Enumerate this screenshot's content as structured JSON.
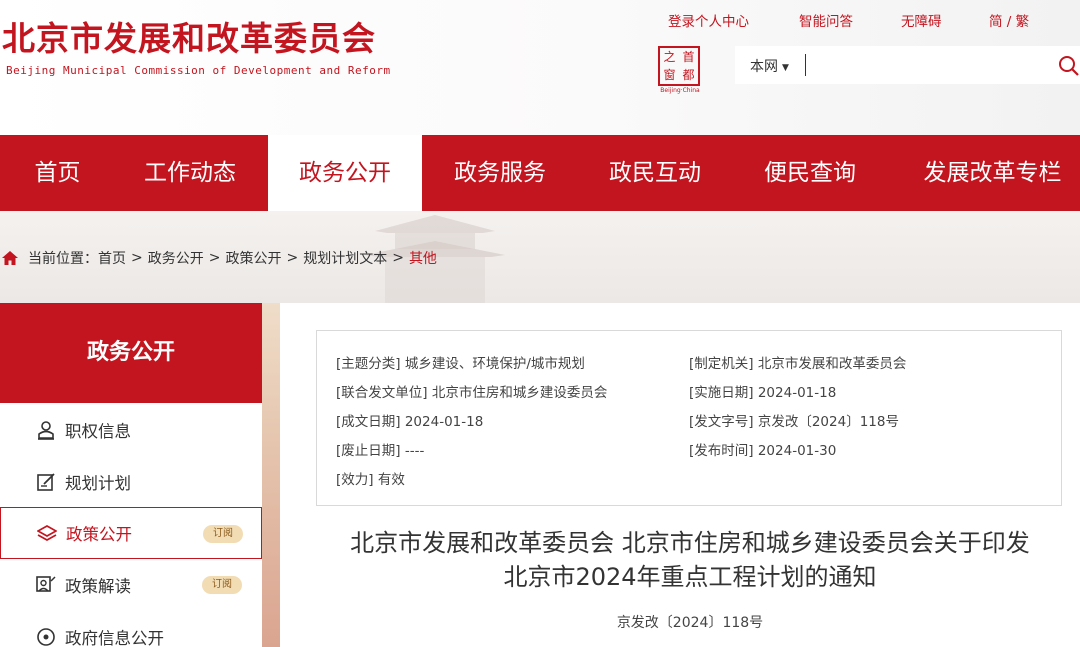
{
  "header": {
    "title": "北京市发展和改革委员会",
    "subtitle": "Beijing Municipal Commission of Development and Reform",
    "top_links": [
      "登录个人中心",
      "智能问答",
      "无障碍",
      "简 / 繁"
    ],
    "logo": {
      "chars": [
        "之",
        "首",
        "窗",
        "都"
      ],
      "caption": "Beijing·China"
    },
    "search": {
      "scope": "本网",
      "placeholder": ""
    }
  },
  "nav": {
    "items": [
      "首页",
      "工作动态",
      "政务公开",
      "政务服务",
      "政民互动",
      "便民查询",
      "发展改革专栏"
    ],
    "active_index": 2
  },
  "breadcrumb": {
    "label": "当前位置：",
    "items": [
      "首页",
      "政务公开",
      "政策公开",
      "规划计划文本",
      "其他"
    ],
    "separator": ">"
  },
  "sidebar": {
    "title": "政务公开",
    "items": [
      {
        "label": "职权信息",
        "icon": "person-badge-icon"
      },
      {
        "label": "规划计划",
        "icon": "edit-note-icon"
      },
      {
        "label": "政策公开",
        "icon": "layers-icon",
        "badge": "订阅"
      },
      {
        "label": "政策解读",
        "icon": "person-chat-icon",
        "badge": "订阅"
      },
      {
        "label": "政府信息公开",
        "icon": "circle-info-icon"
      }
    ],
    "active_index": 2
  },
  "meta": {
    "rows": [
      {
        "label": "[主题分类]",
        "value": "城乡建设、环境保护/城市规划"
      },
      {
        "label": "[制定机关]",
        "value": "北京市发展和改革委员会"
      },
      {
        "label": "[联合发文单位]",
        "value": "北京市住房和城乡建设委员会"
      },
      {
        "label": "[实施日期]",
        "value": "2024-01-18"
      },
      {
        "label": "[成文日期]",
        "value": "2024-01-18"
      },
      {
        "label": "[发文字号]",
        "value": "京发改〔2024〕118号"
      },
      {
        "label": "[废止日期]",
        "value": "----"
      },
      {
        "label": "[发布时间]",
        "value": "2024-01-30"
      },
      {
        "label": "[效力]",
        "value": "有效"
      }
    ]
  },
  "document": {
    "title_line1": "北京市发展和改革委员会 北京市住房和城乡建设委员会关于印发",
    "title_line2": "北京市2024年重点工程计划的通知",
    "number": "京发改〔2024〕118号"
  },
  "colors": {
    "brand_red": "#c3151f",
    "badge_bg": "#f2dcb4"
  }
}
